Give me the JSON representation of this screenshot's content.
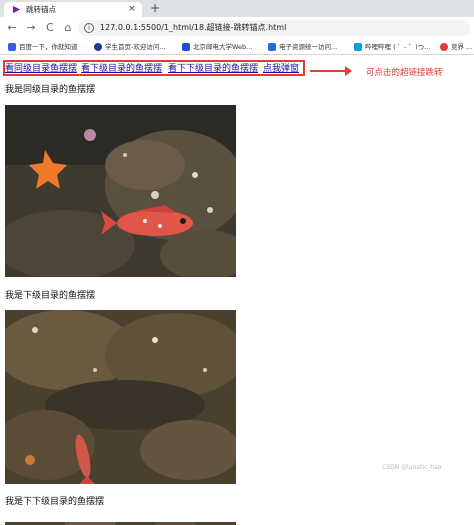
{
  "browser": {
    "tab_title": "跳转锚点",
    "tab_close": "×",
    "new_tab": "+",
    "back_icon": "←",
    "forward_icon": "→",
    "reload_icon": "C",
    "home_icon": "⌂",
    "info_icon": "i",
    "url": "127.0.0.1:5500/1_html/18.超链接-跳转锚点.html"
  },
  "bookmarks": [
    {
      "label": "百度一下，你就知道",
      "color": "#3b5bdb"
    },
    {
      "label": "学生首页-欢迎访问...",
      "color": "#1e3a8a"
    },
    {
      "label": "北京邮电大学Web...",
      "color": "#1d4ed8"
    },
    {
      "label": "电子资源统一访问...",
      "color": "#2563eb"
    },
    {
      "label": "哔哩哔哩 ( ゜- ゜)つ...",
      "color": "#00a1d6"
    },
    {
      "label": "竞界 ...",
      "color": "#e53935"
    }
  ],
  "page": {
    "links": [
      "看同级目录鱼摆摆",
      "看下级目录的鱼摆摆",
      "看下下级目录的鱼摆摆",
      "点我弹窗"
    ],
    "annotation": "可点击的超链接跳转",
    "sections": [
      {
        "heading": "我是同级目录的鱼摆摆"
      },
      {
        "heading": "我是下级目录的鱼摆摆"
      },
      {
        "heading": "我是下下级目录的鱼摆摆"
      }
    ],
    "watermark": "CSDN @lunatic_hao"
  }
}
